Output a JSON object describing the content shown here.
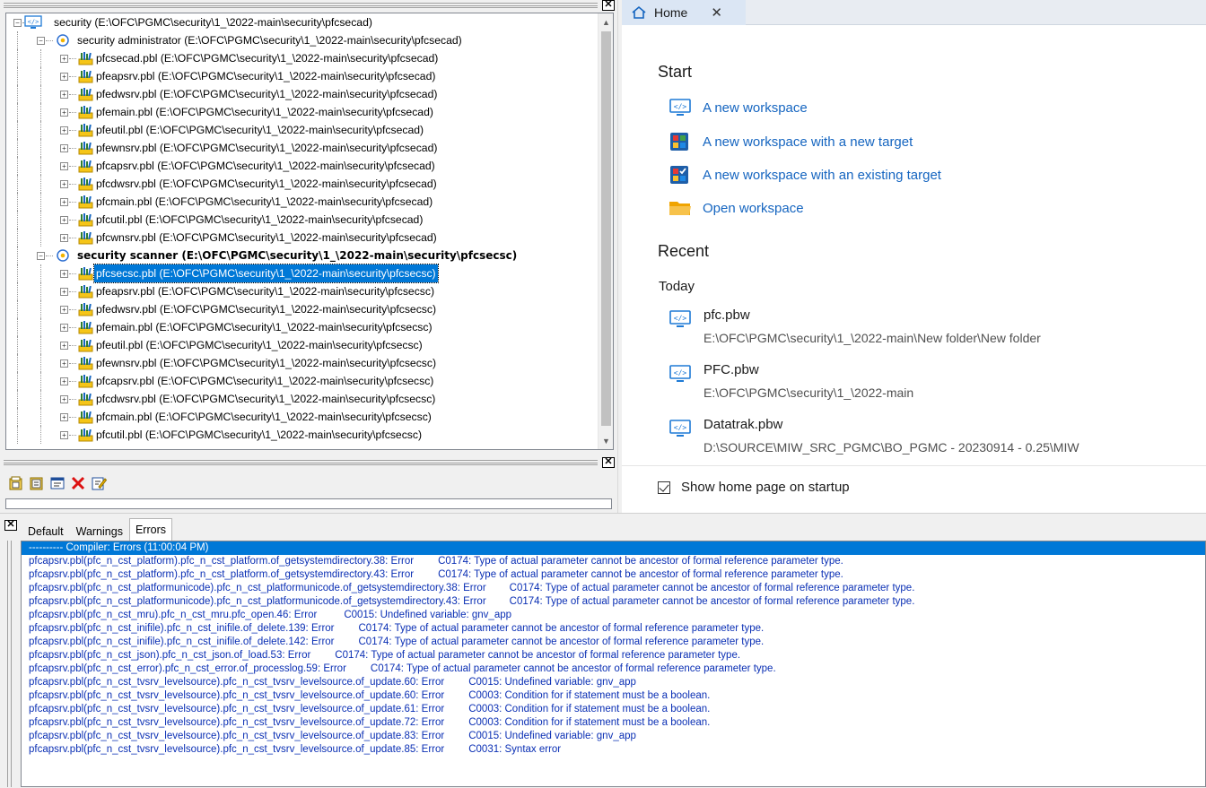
{
  "tree": {
    "root": {
      "label": "security (E:\\OFC\\PGMC\\security\\1_\\2022-main\\security\\pfcsecad)"
    },
    "targets": [
      {
        "label": "security administrator (E:\\OFC\\PGMC\\security\\1_\\2022-main\\security\\pfcsecad)",
        "bold": false,
        "libraries": [
          "pfcsecad.pbl (E:\\OFC\\PGMC\\security\\1_\\2022-main\\security\\pfcsecad)",
          "pfeapsrv.pbl (E:\\OFC\\PGMC\\security\\1_\\2022-main\\security\\pfcsecad)",
          "pfedwsrv.pbl (E:\\OFC\\PGMC\\security\\1_\\2022-main\\security\\pfcsecad)",
          "pfemain.pbl (E:\\OFC\\PGMC\\security\\1_\\2022-main\\security\\pfcsecad)",
          "pfeutil.pbl (E:\\OFC\\PGMC\\security\\1_\\2022-main\\security\\pfcsecad)",
          "pfewnsrv.pbl (E:\\OFC\\PGMC\\security\\1_\\2022-main\\security\\pfcsecad)",
          "pfcapsrv.pbl (E:\\OFC\\PGMC\\security\\1_\\2022-main\\security\\pfcsecad)",
          "pfcdwsrv.pbl (E:\\OFC\\PGMC\\security\\1_\\2022-main\\security\\pfcsecad)",
          "pfcmain.pbl (E:\\OFC\\PGMC\\security\\1_\\2022-main\\security\\pfcsecad)",
          "pfcutil.pbl (E:\\OFC\\PGMC\\security\\1_\\2022-main\\security\\pfcsecad)",
          "pfcwnsrv.pbl (E:\\OFC\\PGMC\\security\\1_\\2022-main\\security\\pfcsecad)"
        ]
      },
      {
        "label": "security scanner (E:\\OFC\\PGMC\\security\\1_\\2022-main\\security\\pfcsecsc)",
        "bold": true,
        "libraries": [
          "pfcsecsc.pbl (E:\\OFC\\PGMC\\security\\1_\\2022-main\\security\\pfcsecsc)",
          "pfeapsrv.pbl (E:\\OFC\\PGMC\\security\\1_\\2022-main\\security\\pfcsecsc)",
          "pfedwsrv.pbl (E:\\OFC\\PGMC\\security\\1_\\2022-main\\security\\pfcsecsc)",
          "pfemain.pbl (E:\\OFC\\PGMC\\security\\1_\\2022-main\\security\\pfcsecsc)",
          "pfeutil.pbl (E:\\OFC\\PGMC\\security\\1_\\2022-main\\security\\pfcsecsc)",
          "pfewnsrv.pbl (E:\\OFC\\PGMC\\security\\1_\\2022-main\\security\\pfcsecsc)",
          "pfcapsrv.pbl (E:\\OFC\\PGMC\\security\\1_\\2022-main\\security\\pfcsecsc)",
          "pfcdwsrv.pbl (E:\\OFC\\PGMC\\security\\1_\\2022-main\\security\\pfcsecsc)",
          "pfcmain.pbl (E:\\OFC\\PGMC\\security\\1_\\2022-main\\security\\pfcsecsc)",
          "pfcutil.pbl (E:\\OFC\\PGMC\\security\\1_\\2022-main\\security\\pfcsecsc)"
        ],
        "selected_index": 0
      }
    ]
  },
  "home": {
    "tab_label": "Home",
    "tab_close": "✕",
    "start_title": "Start",
    "actions": [
      {
        "label": "A new workspace",
        "icon": "workspace-icon"
      },
      {
        "label": "A new workspace with a new target",
        "icon": "new-target-icon"
      },
      {
        "label": "A new workspace with an existing target",
        "icon": "existing-target-icon"
      },
      {
        "label": "Open workspace",
        "icon": "folder-icon"
      }
    ],
    "recent_title": "Recent",
    "today_label": "Today",
    "recent": [
      {
        "name": "pfc.pbw",
        "path": "E:\\OFC\\PGMC\\security\\1_\\2022-main\\New folder\\New folder"
      },
      {
        "name": "PFC.pbw",
        "path": "E:\\OFC\\PGMC\\security\\1_\\2022-main"
      },
      {
        "name": "Datatrak.pbw",
        "path": "D:\\SOURCE\\MIW_SRC_PGMC\\BO_PGMC - 20230914 - 0.25\\MIW"
      }
    ],
    "show_on_startup_label": "Show home page on startup",
    "show_on_startup_checked": true
  },
  "output": {
    "tabs": [
      "Default",
      "Warnings",
      "Errors"
    ],
    "active_tab": "Errors",
    "header": "---------- Compiler: Errors   (11:00:04 PM)",
    "lines": [
      [
        "pfcapsrv.pbl(pfc_n_cst_platform).pfc_n_cst_platform.of_getsystemdirectory.38: Error",
        "C0174: Type of actual parameter cannot be ancestor of formal reference parameter type."
      ],
      [
        "pfcapsrv.pbl(pfc_n_cst_platform).pfc_n_cst_platform.of_getsystemdirectory.43: Error",
        "C0174: Type of actual parameter cannot be ancestor of formal reference parameter type."
      ],
      [
        "pfcapsrv.pbl(pfc_n_cst_platformunicode).pfc_n_cst_platformunicode.of_getsystemdirectory.38: Error",
        "C0174: Type of actual parameter cannot be ancestor of formal reference parameter type."
      ],
      [
        "pfcapsrv.pbl(pfc_n_cst_platformunicode).pfc_n_cst_platformunicode.of_getsystemdirectory.43: Error",
        "C0174: Type of actual parameter cannot be ancestor of formal reference parameter type."
      ],
      [
        "pfcapsrv.pbl(pfc_n_cst_mru).pfc_n_cst_mru.pfc_open.46: Error",
        "C0015: Undefined variable: gnv_app"
      ],
      [
        "pfcapsrv.pbl(pfc_n_cst_inifile).pfc_n_cst_inifile.of_delete.139: Error",
        "C0174: Type of actual parameter cannot be ancestor of formal reference parameter type."
      ],
      [
        "pfcapsrv.pbl(pfc_n_cst_inifile).pfc_n_cst_inifile.of_delete.142: Error",
        "C0174: Type of actual parameter cannot be ancestor of formal reference parameter type."
      ],
      [
        "pfcapsrv.pbl(pfc_n_cst_json).pfc_n_cst_json.of_load.53: Error",
        "C0174: Type of actual parameter cannot be ancestor of formal reference parameter type."
      ],
      [
        "pfcapsrv.pbl(pfc_n_cst_error).pfc_n_cst_error.of_processlog.59: Error",
        "C0174: Type of actual parameter cannot be ancestor of formal reference parameter type."
      ],
      [
        "pfcapsrv.pbl(pfc_n_cst_tvsrv_levelsource).pfc_n_cst_tvsrv_levelsource.of_update.60: Error",
        "C0015: Undefined variable: gnv_app"
      ],
      [
        "pfcapsrv.pbl(pfc_n_cst_tvsrv_levelsource).pfc_n_cst_tvsrv_levelsource.of_update.60: Error",
        "C0003: Condition for if statement must be a boolean."
      ],
      [
        "pfcapsrv.pbl(pfc_n_cst_tvsrv_levelsource).pfc_n_cst_tvsrv_levelsource.of_update.61: Error",
        "C0003: Condition for if statement must be a boolean."
      ],
      [
        "pfcapsrv.pbl(pfc_n_cst_tvsrv_levelsource).pfc_n_cst_tvsrv_levelsource.of_update.72: Error",
        "C0003: Condition for if statement must be a boolean."
      ],
      [
        "pfcapsrv.pbl(pfc_n_cst_tvsrv_levelsource).pfc_n_cst_tvsrv_levelsource.of_update.83: Error",
        "C0015: Undefined variable: gnv_app"
      ],
      [
        "pfcapsrv.pbl(pfc_n_cst_tvsrv_levelsource).pfc_n_cst_tvsrv_levelsource.of_update.85: Error",
        "C0031: Syntax error"
      ]
    ]
  },
  "colors": {
    "accent": "#0078d7",
    "link": "#1565c0",
    "error_text": "#0a2fb4"
  }
}
